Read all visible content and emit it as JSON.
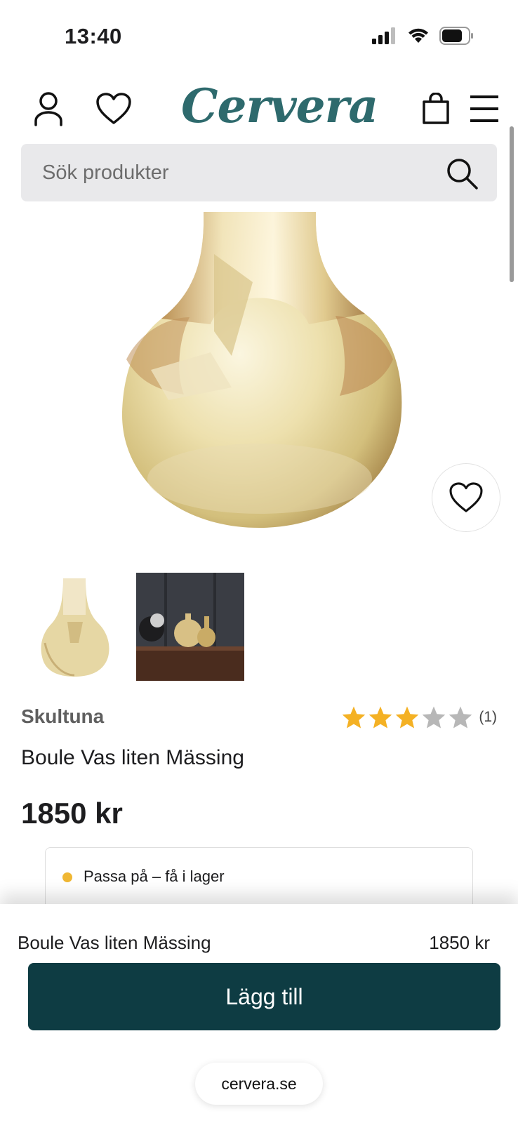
{
  "status_bar": {
    "time": "13:40"
  },
  "header": {
    "logo": "Cervera"
  },
  "search": {
    "placeholder": "Sök produkter"
  },
  "product": {
    "brand": "Skultuna",
    "name": "Boule Vas liten Mässing",
    "price": "1850 kr",
    "rating_stars": 3,
    "rating_max": 5,
    "rating_count": "(1)",
    "stock_status": "Passa på – få i lager"
  },
  "sticky_bar": {
    "name": "Boule Vas liten Mässing",
    "price": "1850 kr",
    "add_label": "Lägg till"
  },
  "browser": {
    "url": "cervera.se"
  },
  "colors": {
    "brand": "#2e6a6d",
    "primary_button": "#0e3c43",
    "star_active": "#f4b124",
    "star_inactive": "#b7b7b7",
    "stock_dot": "#f0b733"
  }
}
